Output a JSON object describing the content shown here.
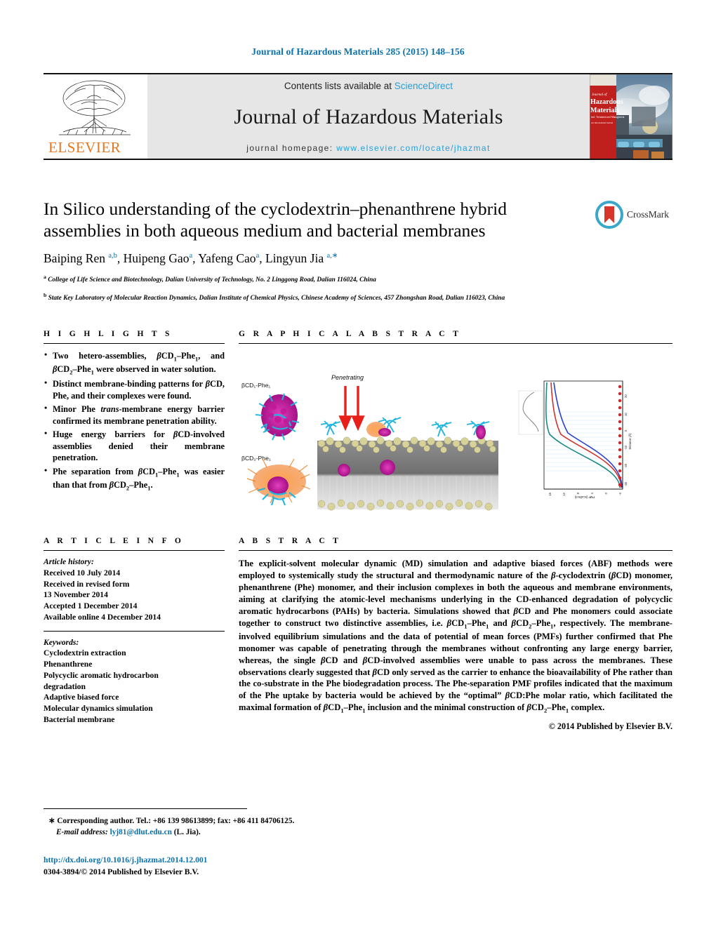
{
  "running_head": "Journal of Hazardous Materials 285 (2015) 148–156",
  "masthead": {
    "contents_prefix": "Contents lists available at",
    "sciencedirect": "ScienceDirect",
    "journal_name": "Journal of Hazardous Materials",
    "homepage_prefix": "journal homepage:",
    "homepage_url": "www.elsevier.com/locate/jhazmat",
    "publisher_wordmark": "ELSEVIER",
    "cover_title_line1": "Journal of",
    "cover_title_line2": "Hazardous",
    "cover_title_line3": "Materials",
    "link_color": "#2a9fd6",
    "elsevier_orange": "#e87722"
  },
  "article": {
    "title": "In Silico understanding of the cyclodextrin–phenanthrene hybrid assemblies in both aqueous medium and bacterial membranes",
    "authors_html": "Baiping Ren <sup>a,b</sup>, Huipeng Gao<sup>a</sup>, Yafeng Cao<sup>a</sup>, Lingyun Jia <sup>a,∗</sup>",
    "affiliation_a": "College of Life Science and Biotechnology, Dalian University of Technology, No. 2 Linggong Road, Dalian 116024, China",
    "affiliation_b": "State Key Laboratory of Molecular Reaction Dynamics, Dalian Institute of Chemical Physics, Chinese Academy of Sciences, 457 Zhongshan Road, Dalian 116023, China",
    "crossmark_label": "CrossMark"
  },
  "sections": {
    "highlights_heading": "H I G H L I G H T S",
    "graphical_abstract_heading": "G R A P H I C A L   A B S T R A C T",
    "article_info_heading": "A R T I C L E   I N F O",
    "abstract_heading": "A B S T R A C T"
  },
  "highlights": [
    "Two hetero-assemblies, <span class=\"gk\">β</span>CD<sub>1</sub>–Phe<sub>1</sub>, and <span class=\"gk\">β</span>CD<sub>2</sub>–Phe<sub>1</sub> were observed in water solution.",
    "Distinct membrane-binding patterns for <span class=\"gk\">β</span>CD, Phe, and their complexes were found.",
    "Minor Phe <i>trans</i>-membrane energy barrier confirmed its membrane penetration ability.",
    "Huge energy barriers for <span class=\"gk\">β</span>CD-involved assemblies denied their membrane penetration.",
    "Phe separation from <span class=\"gk\">β</span>CD<sub>1</sub>–Phe<sub>1</sub> was easier than that from <span class=\"gk\">β</span>CD<sub>2</sub>–Phe<sub>1</sub>."
  ],
  "graphical_abstract": {
    "label_assembly_1": "βCD₁-Phe₁",
    "label_assembly_2": "βCD₂-Phe₁",
    "label_penetrating": "Penetrating",
    "plot_ylabel": "PMF (kcal/mol)",
    "plot_xlabel": "Distance (Å)",
    "arrow_color": "#e8201a",
    "colors": {
      "phe_magenta": "#c3189a",
      "bcd_cyan": "#22b5e0",
      "assembly_orange": "#f07c18",
      "lipid_head": "#d6d29a",
      "lipid_tail": "#8a8a8a"
    }
  },
  "article_info": {
    "history_label": "Article history:",
    "history": [
      "Received 10 July 2014",
      "Received in revised form",
      "13 November 2014",
      "Accepted 1 December 2014",
      "Available online 4 December 2014"
    ],
    "keywords_label": "Keywords:",
    "keywords": [
      "Cyclodextrin extraction",
      "Phenanthrene",
      "Polycyclic aromatic hydrocarbon",
      "degradation",
      "Adaptive biased force",
      "Molecular dynamics simulation",
      "Bacterial membrane"
    ]
  },
  "abstract": {
    "text_html": "The explicit-solvent molecular dynamic (MD) simulation and adaptive biased forces (ABF) methods were employed to systemically study the structural and thermodynamic nature of the <span class=\"gk\">β</span>-cyclodextrin (<span class=\"gk\">β</span>CD) monomer, phenanthrene (Phe) monomer, and their inclusion complexes in both the aqueous and membrane environments, aiming at clarifying the atomic-level mechanisms underlying in the CD-enhanced degradation of polycyclic aromatic hydrocarbons (PAHs) by bacteria. Simulations showed that <span class=\"gk\">β</span>CD and Phe monomers could associate together to construct two distinctive assemblies, i.e. <span class=\"gk\">β</span>CD<sub>1</sub>–Phe<sub>1</sub> and <span class=\"gk\">β</span>CD<sub>2</sub>–Phe<sub>1</sub>, respectively. The membrane-involved equilibrium simulations and the data of potential of mean forces (PMFs) further confirmed that Phe monomer was capable of penetrating through the membranes without confronting any large energy barrier, whereas, the single <span class=\"gk\">β</span>CD and <span class=\"gk\">β</span>CD-involved assemblies were unable to pass across the membranes. These observations clearly suggested that <span class=\"gk\">β</span>CD only served as the carrier to enhance the bioavailability of Phe rather than the co-substrate in the Phe biodegradation process. The Phe-separation PMF profiles indicated that the maximum of the Phe uptake by bacteria would be achieved by the “optimal” <span class=\"gk\">β</span>CD:Phe molar ratio, which facilitated the maximal formation of <span class=\"gk\">β</span>CD<sub>1</sub>–Phe<sub>1</sub> inclusion and the minimal construction of <span class=\"gk\">β</span>CD<sub>2</sub>–Phe<sub>1</sub> complex.",
    "copyright": "© 2014 Published by Elsevier B.V."
  },
  "footer": {
    "corresponding_marker": "∗",
    "corresponding_text": "Corresponding author. Tel.: +86 139 98613899; fax: +86 411 84706125.",
    "email_label": "E-mail address:",
    "email": "lyj81@dlut.edu.cn",
    "email_suffix": "(L. Jia).",
    "doi_url": "http://dx.doi.org/10.1016/j.jhazmat.2014.12.001",
    "issn_line": "0304-3894/© 2014 Published by Elsevier B.V."
  }
}
